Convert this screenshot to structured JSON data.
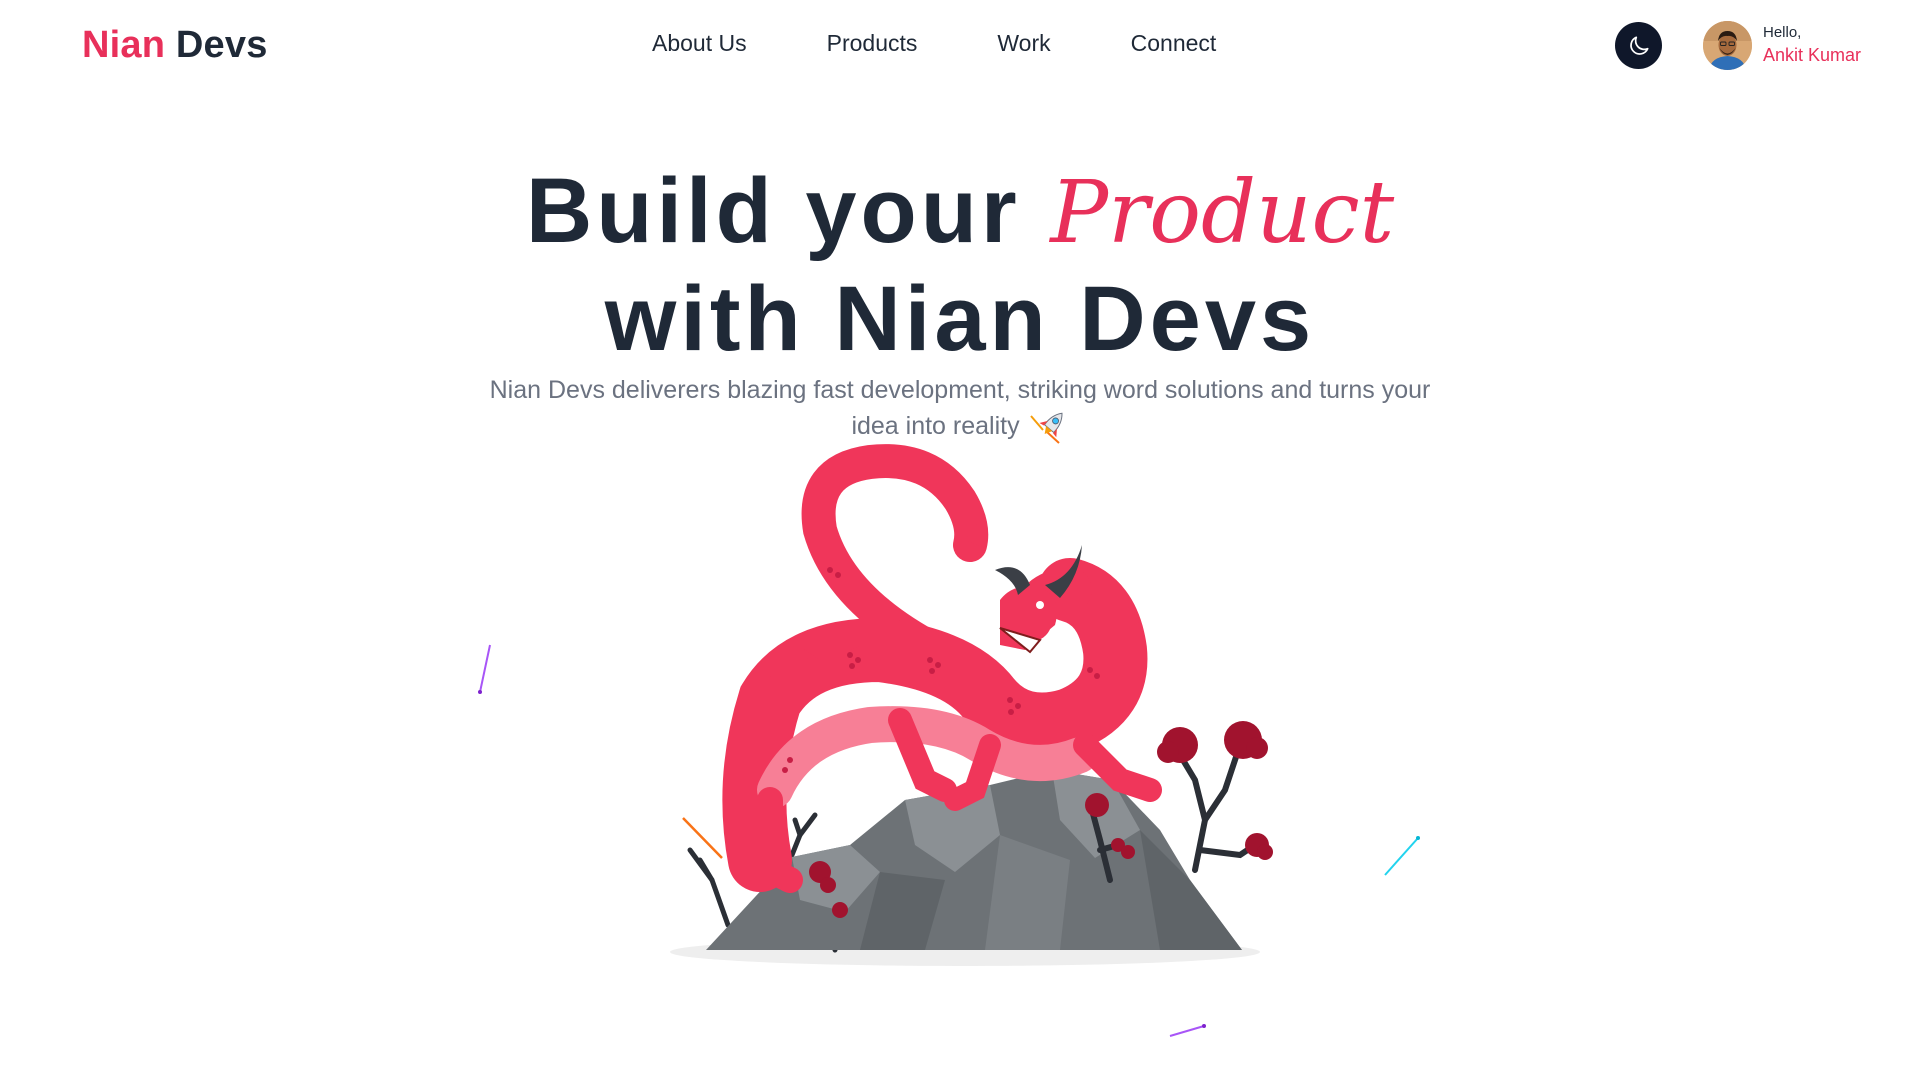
{
  "header": {
    "logo_part1": "Nian",
    "logo_part2": " Devs",
    "nav": [
      "About Us",
      "Products",
      "Work",
      "Connect"
    ],
    "theme_icon": "moon-icon",
    "user": {
      "greeting": "Hello,",
      "name": "Ankit Kumar"
    }
  },
  "hero": {
    "title_line1_start": "Build your ",
    "title_accent": "Product",
    "title_line2": "with Nian Devs",
    "subtitle": "Nian Devs deliverers blazing fast development, striking word solutions and turns your idea into reality",
    "subtitle_icon": "rocket-icon",
    "illustration": "red-dragon-on-mountain-illustration"
  },
  "colors": {
    "accent": "#e8305a",
    "text_dark": "#1f2937",
    "text_muted": "#6b7280",
    "toggle_bg": "#0f172a"
  }
}
